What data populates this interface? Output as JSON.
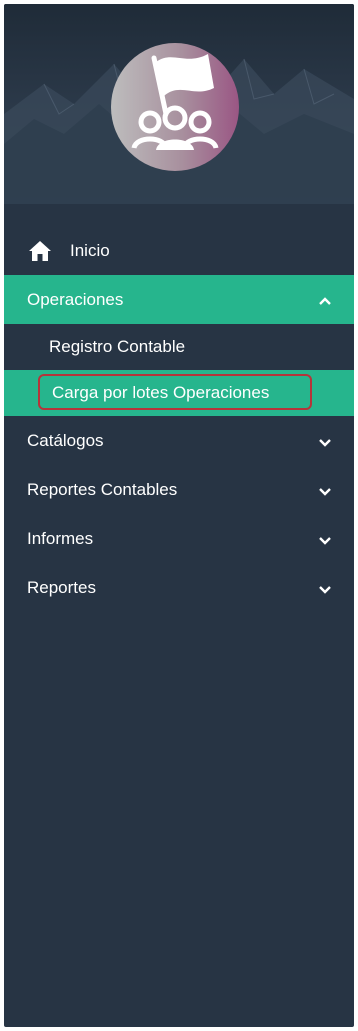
{
  "menu": {
    "home_label": "Inicio",
    "operaciones_label": "Operaciones",
    "sub_items": [
      {
        "label": "Registro Contable"
      },
      {
        "label": "Carga por lotes Operaciones"
      }
    ],
    "catalogos_label": "Catálogos",
    "reportes_contables_label": "Reportes Contables",
    "informes_label": "Informes",
    "reportes_label": "Reportes"
  },
  "icons": {
    "home": "home-icon",
    "expanded": "chevron-up-icon",
    "collapsed": "chevron-down-icon",
    "logo": "group-flag-logo"
  },
  "colors": {
    "sidebar_bg": "#273444",
    "active_bg": "#26b58d",
    "highlight_border": "#b5343a",
    "logo_gradient_start": "#b8b8b8",
    "logo_gradient_end": "#9c5b86"
  }
}
